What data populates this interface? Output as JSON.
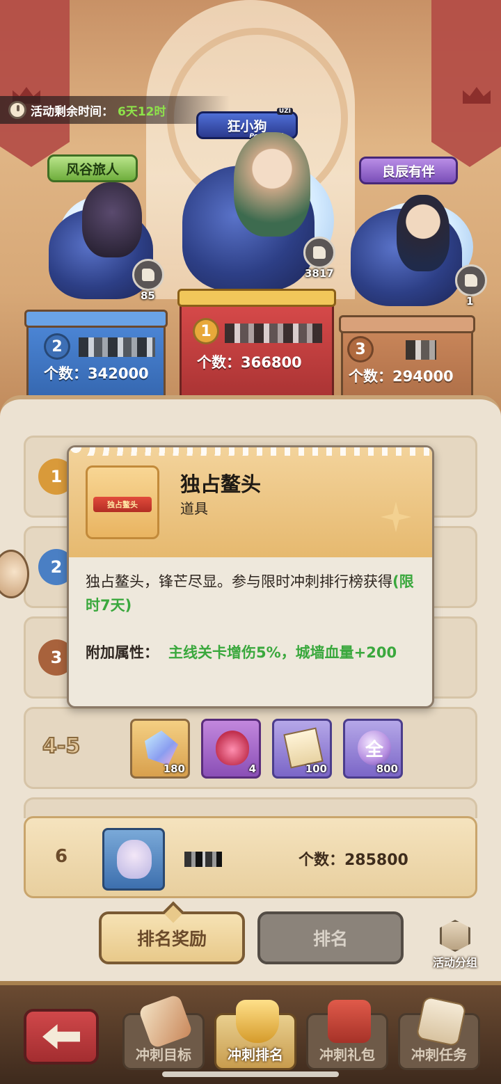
{
  "header": {
    "timer_label": "活动剩余时间：",
    "timer_value": "6天12时"
  },
  "podium": {
    "first": {
      "title": "狂小狗",
      "title_sub": "Penta Kill",
      "title_tag": "UZI",
      "likes": "3817",
      "rank": "1",
      "count_text": "个数：366800"
    },
    "second": {
      "title": "风谷旅人",
      "likes": "85",
      "rank": "2",
      "count_text": "个数：342000"
    },
    "third": {
      "title": "良辰有伴",
      "likes": "1",
      "rank": "3",
      "count_text": "个数：294000"
    }
  },
  "ranking_rows": [
    {
      "rank": "1"
    },
    {
      "rank": "2"
    },
    {
      "rank": "3"
    },
    {
      "range": "4-5",
      "items": [
        {
          "icon": "crystal-shard-icon",
          "count": "180"
        },
        {
          "icon": "flame-spirit-icon",
          "count": "4"
        },
        {
          "icon": "integral-scroll-icon",
          "count": "100"
        },
        {
          "icon": "quan-token-icon",
          "glyph": "全",
          "count": "800"
        }
      ]
    }
  ],
  "my_entry": {
    "rank": "6",
    "count_text": "个数：285800"
  },
  "tabs": {
    "reward": "排名奖励",
    "ranking": "排名"
  },
  "group_button": "活动分组",
  "tooltip": {
    "item_badge": "独占鳌头",
    "title": "独占鳌头",
    "type": "道具",
    "desc_main": "独占鳌头，锋芒尽显。参与限时冲刺排行榜获得",
    "desc_limit": "(限时7天)",
    "attr_label": "附加属性：",
    "attr_value": "主线关卡增伤5%，城墙血量+200"
  },
  "bottom_nav": [
    {
      "label": "冲刺目标",
      "icon": "scroll-target-icon",
      "active": false
    },
    {
      "label": "冲刺排名",
      "icon": "trophy-icon",
      "active": true
    },
    {
      "label": "冲刺礼包",
      "icon": "treasure-chest-icon",
      "active": false
    },
    {
      "label": "冲刺任务",
      "icon": "quest-paper-icon",
      "active": false
    }
  ],
  "colors": {
    "accent_green": "#3aa83d",
    "timer_green": "#8ee34a",
    "rank1_red": "#a12f2f",
    "rank2_blue": "#2f5fa6",
    "rank3_bronze": "#a86a44"
  }
}
